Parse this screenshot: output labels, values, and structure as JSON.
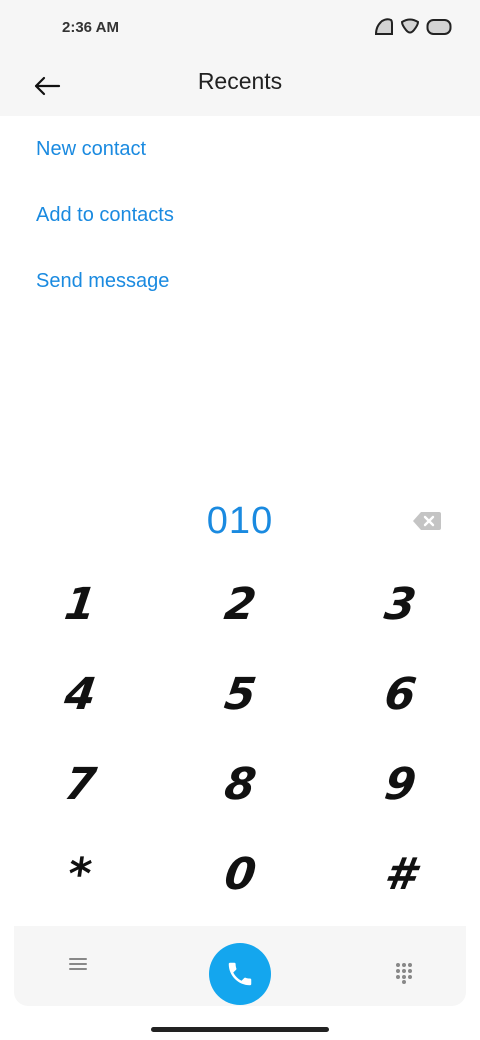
{
  "status": {
    "time": "2:36 AM"
  },
  "appbar": {
    "title": "Recents"
  },
  "actions": [
    {
      "label": "New contact"
    },
    {
      "label": "Add to contacts"
    },
    {
      "label": "Send message"
    }
  ],
  "dialer": {
    "number": "010",
    "keys": [
      "1",
      "2",
      "3",
      "4",
      "5",
      "6",
      "7",
      "8",
      "9",
      "*",
      "0",
      "#"
    ]
  },
  "colors": {
    "accent": "#1a8ae0",
    "call_button": "#14a6ee",
    "bar_background": "#f6f6f6"
  }
}
